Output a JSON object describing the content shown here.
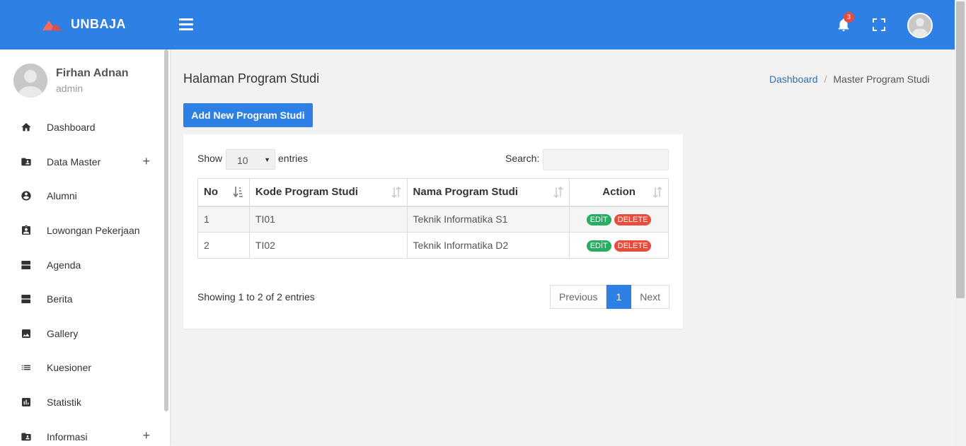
{
  "brand": {
    "name": "UNBAJA"
  },
  "topbar": {
    "notification_count": "3"
  },
  "user": {
    "name": "Firhan Adnan",
    "role": "admin"
  },
  "sidebar": {
    "items": [
      {
        "label": "Dashboard",
        "icon": "home-icon"
      },
      {
        "label": "Data Master",
        "icon": "folder-account-icon",
        "expandable": true
      },
      {
        "label": "Alumni",
        "icon": "account-circle-icon"
      },
      {
        "label": "Lowongan Pekerjaan",
        "icon": "clipboard-account-icon"
      },
      {
        "label": "Agenda",
        "icon": "view-agenda-icon"
      },
      {
        "label": "Berita",
        "icon": "view-agenda-icon"
      },
      {
        "label": "Gallery",
        "icon": "image-icon"
      },
      {
        "label": "Kuesioner",
        "icon": "list-icon"
      },
      {
        "label": "Statistik",
        "icon": "bar-chart-icon"
      },
      {
        "label": "Informasi",
        "icon": "folder-account-icon",
        "expandable": true
      }
    ],
    "expand_symbol": "+"
  },
  "page": {
    "title": "Halaman Program Studi",
    "breadcrumb": [
      "Dashboard",
      "Master Program Studi"
    ],
    "breadcrumb_sep": "/",
    "add_button": "Add New Program Studi"
  },
  "table_controls": {
    "show_label": "Show",
    "entries_value": "10",
    "entries_label": "entries",
    "search_label": "Search:",
    "search_value": ""
  },
  "table": {
    "headers": [
      "No",
      "Kode Program Studi",
      "Nama Program Studi",
      "Action"
    ],
    "rows": [
      {
        "no": "1",
        "kode": "TI01",
        "nama": "Teknik Informatika S1"
      },
      {
        "no": "2",
        "kode": "TI02",
        "nama": "Teknik Informatika D2"
      }
    ],
    "edit_label": "EDİT",
    "delete_label": "DELETE"
  },
  "pagination": {
    "info": "Showing 1 to 2 of 2 entries",
    "previous": "Previous",
    "current": "1",
    "next": "Next"
  },
  "colors": {
    "primary": "#2f80e4",
    "success": "#27ae60",
    "danger": "#e74c3c"
  }
}
